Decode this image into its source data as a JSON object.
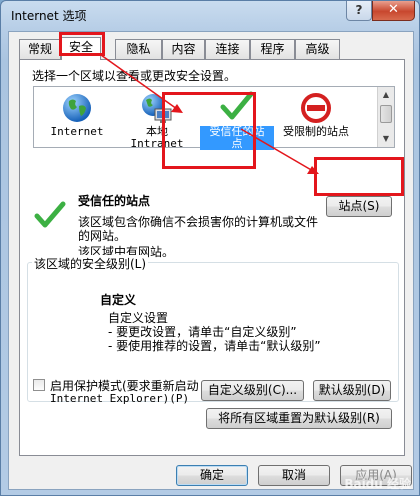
{
  "window": {
    "title": "Internet 选项",
    "help_label": "?",
    "close_label": "✕"
  },
  "tabs": [
    {
      "label": "常规"
    },
    {
      "label": "安全"
    },
    {
      "label": "隐私"
    },
    {
      "label": "内容"
    },
    {
      "label": "连接"
    },
    {
      "label": "程序"
    },
    {
      "label": "高级"
    }
  ],
  "active_tab": "安全",
  "security": {
    "prompt": "选择一个区域以查看或更改安全设置。",
    "zones": [
      {
        "label": "Internet",
        "icon": "globe-icon"
      },
      {
        "label": "本地 Intranet",
        "line1": "本地",
        "line2": "Intranet",
        "icon": "intranet-icon"
      },
      {
        "label": "受信任的站点",
        "line1": "受信任的站",
        "line2": "点",
        "icon": "green-check-icon",
        "selected": true
      },
      {
        "label": "受限制的站点",
        "icon": "restricted-icon"
      }
    ],
    "zone_title": "受信任的站点",
    "zone_desc_line1": "该区域包含你确信不会损害你的计算机或文件",
    "zone_desc_line2": "的网站。",
    "zone_status": "该区域中有网站。",
    "sites_button": "站点(S)",
    "level_group_label": "该区域的安全级别(L)",
    "level_name": "自定义",
    "level_line1": "自定义设置",
    "level_line2": "- 要更改设置，请单击“自定义级别”",
    "level_line3": "- 要使用推荐的设置，请单击“默认级别”",
    "protected_mode_line1": "启用保护模式(要求重新启动",
    "protected_mode_line2": "Internet Explorer)(P)",
    "protected_mode_checked": false,
    "custom_level_button": "自定义级别(C)...",
    "default_level_button": "默认级别(D)",
    "reset_all_button": "将所有区域重置为默认级别(R)"
  },
  "footer": {
    "ok": "确定",
    "cancel": "取消",
    "apply": "应用(A)"
  },
  "watermark": "Baidu 经验",
  "colors": {
    "highlight_red": "#e3161c",
    "selection_blue": "#3399ff",
    "check_green": "#3cb043"
  }
}
